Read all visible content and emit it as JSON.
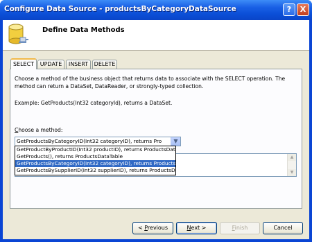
{
  "window": {
    "title": "Configure Data Source - productsByCategoryDataSource",
    "help_button": "?",
    "close_button": "X"
  },
  "header": {
    "title": "Define Data Methods"
  },
  "tabs": [
    {
      "label": "SELECT",
      "active": true
    },
    {
      "label": "UPDATE",
      "active": false
    },
    {
      "label": "INSERT",
      "active": false
    },
    {
      "label": "DELETE",
      "active": false
    }
  ],
  "select_panel": {
    "description": "Choose a method of the business object that returns data to associate with the SELECT operation. The method can return a DataSet, DataReader, or strongly-typed collection.",
    "example": "Example: GetProducts(Int32 categoryId), returns a DataSet.",
    "choose_label_accesskey": "C",
    "choose_label_rest": "hoose a method:",
    "selected_value": "GetProductsByCategoryID(Int32 categoryID), returns Pro",
    "options": [
      "GetProductByProductID(Int32 productID), returns ProductsDataTable",
      "GetProducts(), returns ProductsDataTable",
      "GetProductsByCategoryID(Int32 categoryID), returns ProductsDataTable",
      "GetProductsBySupplierID(Int32 supplierID), returns ProductsDataTable"
    ],
    "highlighted_option_index": 2
  },
  "buttons": {
    "previous": {
      "prefix": "< ",
      "accesskey": "P",
      "rest": "revious"
    },
    "next": {
      "accesskey": "N",
      "rest": "ext >"
    },
    "finish": {
      "accesskey": "F",
      "rest": "inish"
    },
    "cancel": {
      "label": "Cancel"
    }
  },
  "colors": {
    "titlebar": "#0a45d4",
    "highlight": "#316ac5",
    "active_tab_accent": "#f1b848"
  }
}
